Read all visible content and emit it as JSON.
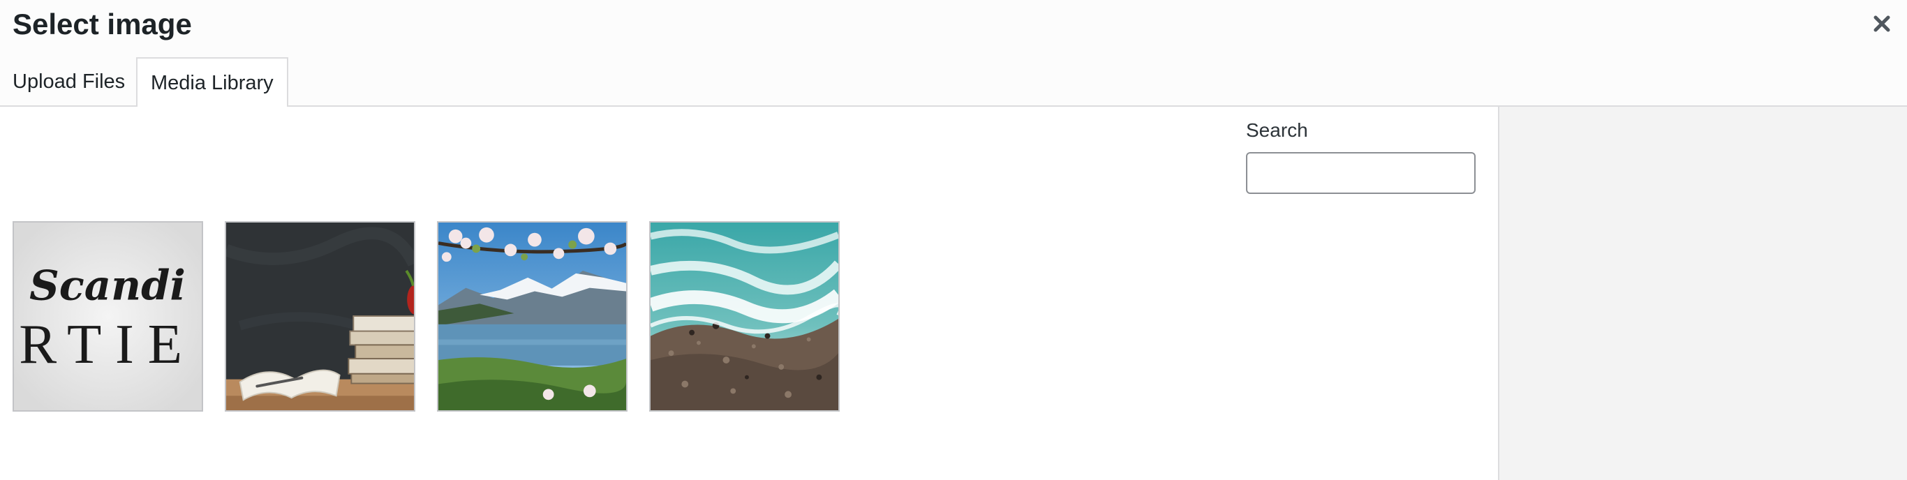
{
  "modal": {
    "title": "Select image",
    "close_icon": "close-icon"
  },
  "tabs": [
    {
      "label": "Upload Files",
      "active": false
    },
    {
      "label": "Media Library",
      "active": true
    }
  ],
  "search": {
    "label": "Search",
    "value": "",
    "placeholder": ""
  },
  "attachments": [
    {
      "name": "scandi-sign-image",
      "visible_text_top": "Scandi",
      "visible_text_bottom": "RTIE"
    },
    {
      "name": "books-chalkboard-image"
    },
    {
      "name": "fjord-blossoms-image"
    },
    {
      "name": "ocean-shore-aerial-image"
    }
  ],
  "colors": {
    "header_bg": "#fcfcfc",
    "border": "#dcdcde",
    "sidebar_bg": "#f3f3f3",
    "text": "#1d2327"
  }
}
